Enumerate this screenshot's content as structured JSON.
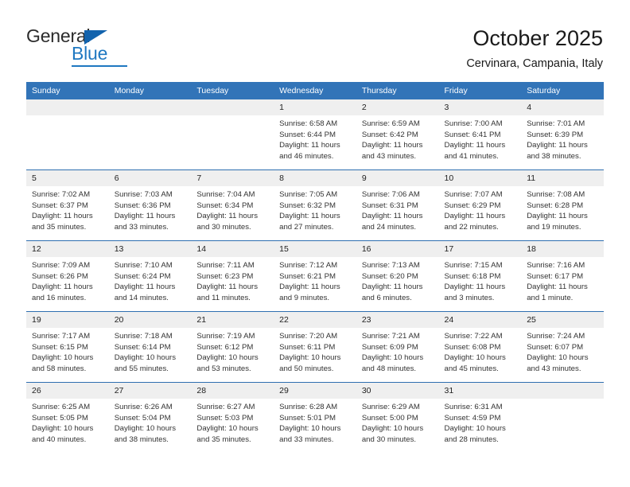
{
  "brand": {
    "name_top": "General",
    "name_bottom": "Blue",
    "accent_color": "#1f78c1",
    "triangle_color": "#1263ad",
    "triangle_icon": "triangle-icon"
  },
  "header": {
    "title": "October 2025",
    "subtitle": "Cervinara, Campania, Italy"
  },
  "calendar": {
    "header_bg": "#3274b8",
    "daynum_bg": "#efefef",
    "row_separator_color": "#2f6fb0",
    "weekday_labels": [
      "Sunday",
      "Monday",
      "Tuesday",
      "Wednesday",
      "Thursday",
      "Friday",
      "Saturday"
    ],
    "weeks": [
      [
        {
          "day": "",
          "blank": true
        },
        {
          "day": "",
          "blank": true
        },
        {
          "day": "",
          "blank": true
        },
        {
          "day": "1",
          "sunrise": "Sunrise: 6:58 AM",
          "sunset": "Sunset: 6:44 PM",
          "daylight1": "Daylight: 11 hours",
          "daylight2": "and 46 minutes."
        },
        {
          "day": "2",
          "sunrise": "Sunrise: 6:59 AM",
          "sunset": "Sunset: 6:42 PM",
          "daylight1": "Daylight: 11 hours",
          "daylight2": "and 43 minutes."
        },
        {
          "day": "3",
          "sunrise": "Sunrise: 7:00 AM",
          "sunset": "Sunset: 6:41 PM",
          "daylight1": "Daylight: 11 hours",
          "daylight2": "and 41 minutes."
        },
        {
          "day": "4",
          "sunrise": "Sunrise: 7:01 AM",
          "sunset": "Sunset: 6:39 PM",
          "daylight1": "Daylight: 11 hours",
          "daylight2": "and 38 minutes."
        }
      ],
      [
        {
          "day": "5",
          "sunrise": "Sunrise: 7:02 AM",
          "sunset": "Sunset: 6:37 PM",
          "daylight1": "Daylight: 11 hours",
          "daylight2": "and 35 minutes."
        },
        {
          "day": "6",
          "sunrise": "Sunrise: 7:03 AM",
          "sunset": "Sunset: 6:36 PM",
          "daylight1": "Daylight: 11 hours",
          "daylight2": "and 33 minutes."
        },
        {
          "day": "7",
          "sunrise": "Sunrise: 7:04 AM",
          "sunset": "Sunset: 6:34 PM",
          "daylight1": "Daylight: 11 hours",
          "daylight2": "and 30 minutes."
        },
        {
          "day": "8",
          "sunrise": "Sunrise: 7:05 AM",
          "sunset": "Sunset: 6:32 PM",
          "daylight1": "Daylight: 11 hours",
          "daylight2": "and 27 minutes."
        },
        {
          "day": "9",
          "sunrise": "Sunrise: 7:06 AM",
          "sunset": "Sunset: 6:31 PM",
          "daylight1": "Daylight: 11 hours",
          "daylight2": "and 24 minutes."
        },
        {
          "day": "10",
          "sunrise": "Sunrise: 7:07 AM",
          "sunset": "Sunset: 6:29 PM",
          "daylight1": "Daylight: 11 hours",
          "daylight2": "and 22 minutes."
        },
        {
          "day": "11",
          "sunrise": "Sunrise: 7:08 AM",
          "sunset": "Sunset: 6:28 PM",
          "daylight1": "Daylight: 11 hours",
          "daylight2": "and 19 minutes."
        }
      ],
      [
        {
          "day": "12",
          "sunrise": "Sunrise: 7:09 AM",
          "sunset": "Sunset: 6:26 PM",
          "daylight1": "Daylight: 11 hours",
          "daylight2": "and 16 minutes."
        },
        {
          "day": "13",
          "sunrise": "Sunrise: 7:10 AM",
          "sunset": "Sunset: 6:24 PM",
          "daylight1": "Daylight: 11 hours",
          "daylight2": "and 14 minutes."
        },
        {
          "day": "14",
          "sunrise": "Sunrise: 7:11 AM",
          "sunset": "Sunset: 6:23 PM",
          "daylight1": "Daylight: 11 hours",
          "daylight2": "and 11 minutes."
        },
        {
          "day": "15",
          "sunrise": "Sunrise: 7:12 AM",
          "sunset": "Sunset: 6:21 PM",
          "daylight1": "Daylight: 11 hours",
          "daylight2": "and 9 minutes."
        },
        {
          "day": "16",
          "sunrise": "Sunrise: 7:13 AM",
          "sunset": "Sunset: 6:20 PM",
          "daylight1": "Daylight: 11 hours",
          "daylight2": "and 6 minutes."
        },
        {
          "day": "17",
          "sunrise": "Sunrise: 7:15 AM",
          "sunset": "Sunset: 6:18 PM",
          "daylight1": "Daylight: 11 hours",
          "daylight2": "and 3 minutes."
        },
        {
          "day": "18",
          "sunrise": "Sunrise: 7:16 AM",
          "sunset": "Sunset: 6:17 PM",
          "daylight1": "Daylight: 11 hours",
          "daylight2": "and 1 minute."
        }
      ],
      [
        {
          "day": "19",
          "sunrise": "Sunrise: 7:17 AM",
          "sunset": "Sunset: 6:15 PM",
          "daylight1": "Daylight: 10 hours",
          "daylight2": "and 58 minutes."
        },
        {
          "day": "20",
          "sunrise": "Sunrise: 7:18 AM",
          "sunset": "Sunset: 6:14 PM",
          "daylight1": "Daylight: 10 hours",
          "daylight2": "and 55 minutes."
        },
        {
          "day": "21",
          "sunrise": "Sunrise: 7:19 AM",
          "sunset": "Sunset: 6:12 PM",
          "daylight1": "Daylight: 10 hours",
          "daylight2": "and 53 minutes."
        },
        {
          "day": "22",
          "sunrise": "Sunrise: 7:20 AM",
          "sunset": "Sunset: 6:11 PM",
          "daylight1": "Daylight: 10 hours",
          "daylight2": "and 50 minutes."
        },
        {
          "day": "23",
          "sunrise": "Sunrise: 7:21 AM",
          "sunset": "Sunset: 6:09 PM",
          "daylight1": "Daylight: 10 hours",
          "daylight2": "and 48 minutes."
        },
        {
          "day": "24",
          "sunrise": "Sunrise: 7:22 AM",
          "sunset": "Sunset: 6:08 PM",
          "daylight1": "Daylight: 10 hours",
          "daylight2": "and 45 minutes."
        },
        {
          "day": "25",
          "sunrise": "Sunrise: 7:24 AM",
          "sunset": "Sunset: 6:07 PM",
          "daylight1": "Daylight: 10 hours",
          "daylight2": "and 43 minutes."
        }
      ],
      [
        {
          "day": "26",
          "sunrise": "Sunrise: 6:25 AM",
          "sunset": "Sunset: 5:05 PM",
          "daylight1": "Daylight: 10 hours",
          "daylight2": "and 40 minutes."
        },
        {
          "day": "27",
          "sunrise": "Sunrise: 6:26 AM",
          "sunset": "Sunset: 5:04 PM",
          "daylight1": "Daylight: 10 hours",
          "daylight2": "and 38 minutes."
        },
        {
          "day": "28",
          "sunrise": "Sunrise: 6:27 AM",
          "sunset": "Sunset: 5:03 PM",
          "daylight1": "Daylight: 10 hours",
          "daylight2": "and 35 minutes."
        },
        {
          "day": "29",
          "sunrise": "Sunrise: 6:28 AM",
          "sunset": "Sunset: 5:01 PM",
          "daylight1": "Daylight: 10 hours",
          "daylight2": "and 33 minutes."
        },
        {
          "day": "30",
          "sunrise": "Sunrise: 6:29 AM",
          "sunset": "Sunset: 5:00 PM",
          "daylight1": "Daylight: 10 hours",
          "daylight2": "and 30 minutes."
        },
        {
          "day": "31",
          "sunrise": "Sunrise: 6:31 AM",
          "sunset": "Sunset: 4:59 PM",
          "daylight1": "Daylight: 10 hours",
          "daylight2": "and 28 minutes."
        },
        {
          "day": "",
          "blank": true
        }
      ]
    ]
  }
}
